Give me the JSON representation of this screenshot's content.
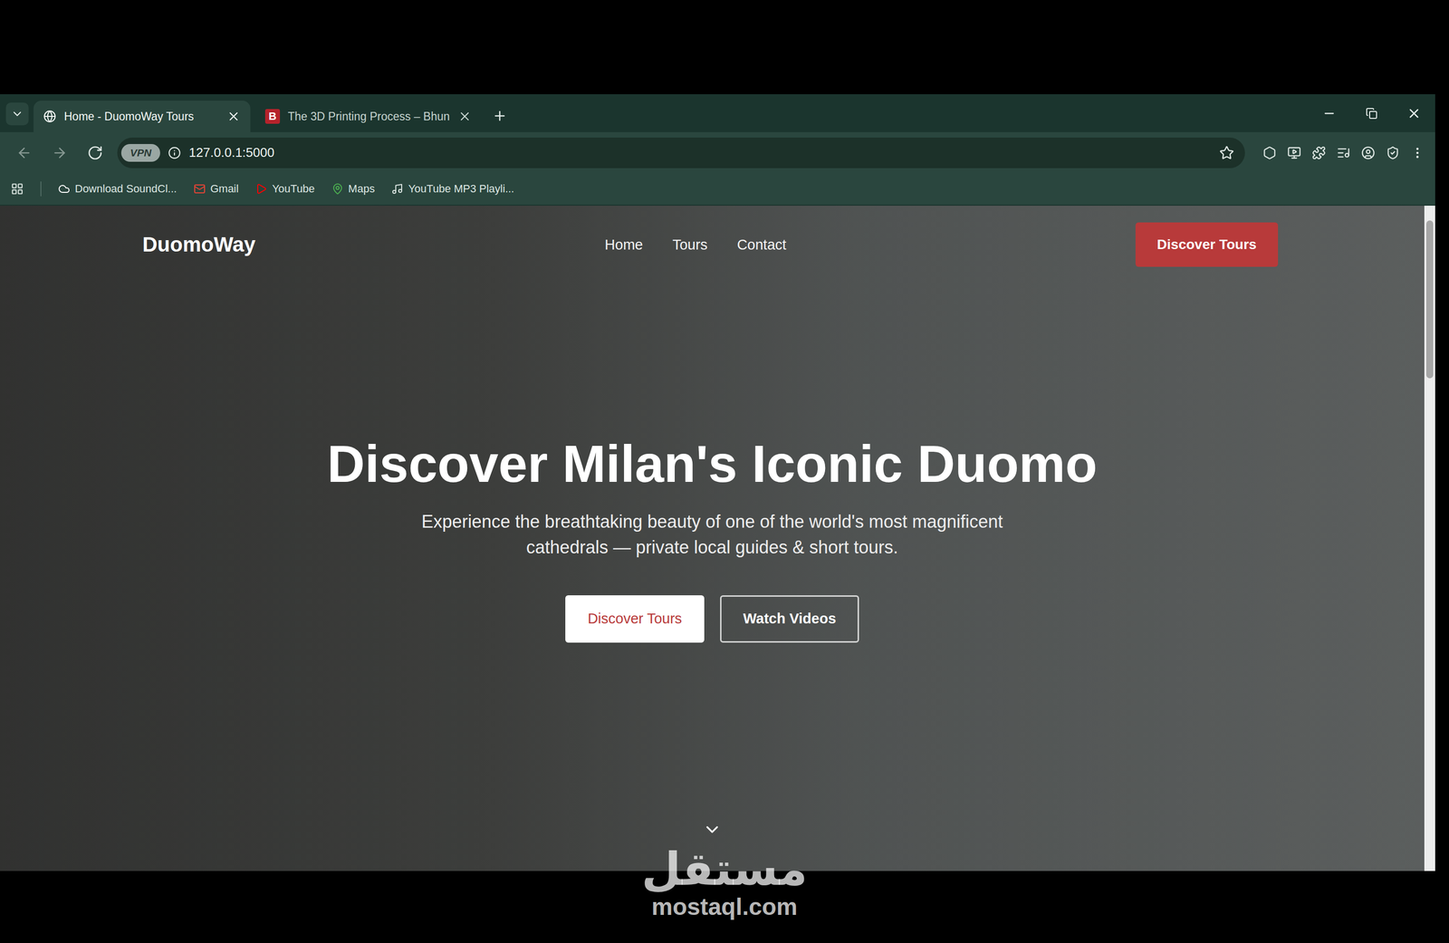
{
  "tabs": [
    {
      "label": "Home - DuomoWay Tours",
      "selected": true,
      "favicon": ""
    },
    {
      "label": "The 3D Printing Process – Bhun",
      "selected": false,
      "favicon": "B"
    }
  ],
  "address_bar": {
    "badge": "VPN",
    "url": "127.0.0.1:5000",
    "bookmarked": false
  },
  "bookmarks": [
    {
      "label": "Download SoundCl..."
    },
    {
      "label": "Gmail"
    },
    {
      "label": "YouTube"
    },
    {
      "label": "Maps"
    },
    {
      "label": "YouTube MP3 Playli..."
    }
  ],
  "site": {
    "logo": "DuomoWay",
    "nav": [
      {
        "label": "Home"
      },
      {
        "label": "Tours"
      },
      {
        "label": "Contact"
      }
    ],
    "cta": "Discover Tours",
    "hero": {
      "title": "Discover Milan's Iconic Duomo",
      "subtitle": "Experience the breathtaking beauty of one of the world's most magnificent cathedrals — private local guides & short tours.",
      "buttons": [
        {
          "label": "Discover Tours",
          "kind": "primary"
        },
        {
          "label": "Watch Videos",
          "kind": "outline"
        }
      ]
    }
  },
  "watermark": {
    "script": "مستقل",
    "domain": "mostaql.com"
  }
}
